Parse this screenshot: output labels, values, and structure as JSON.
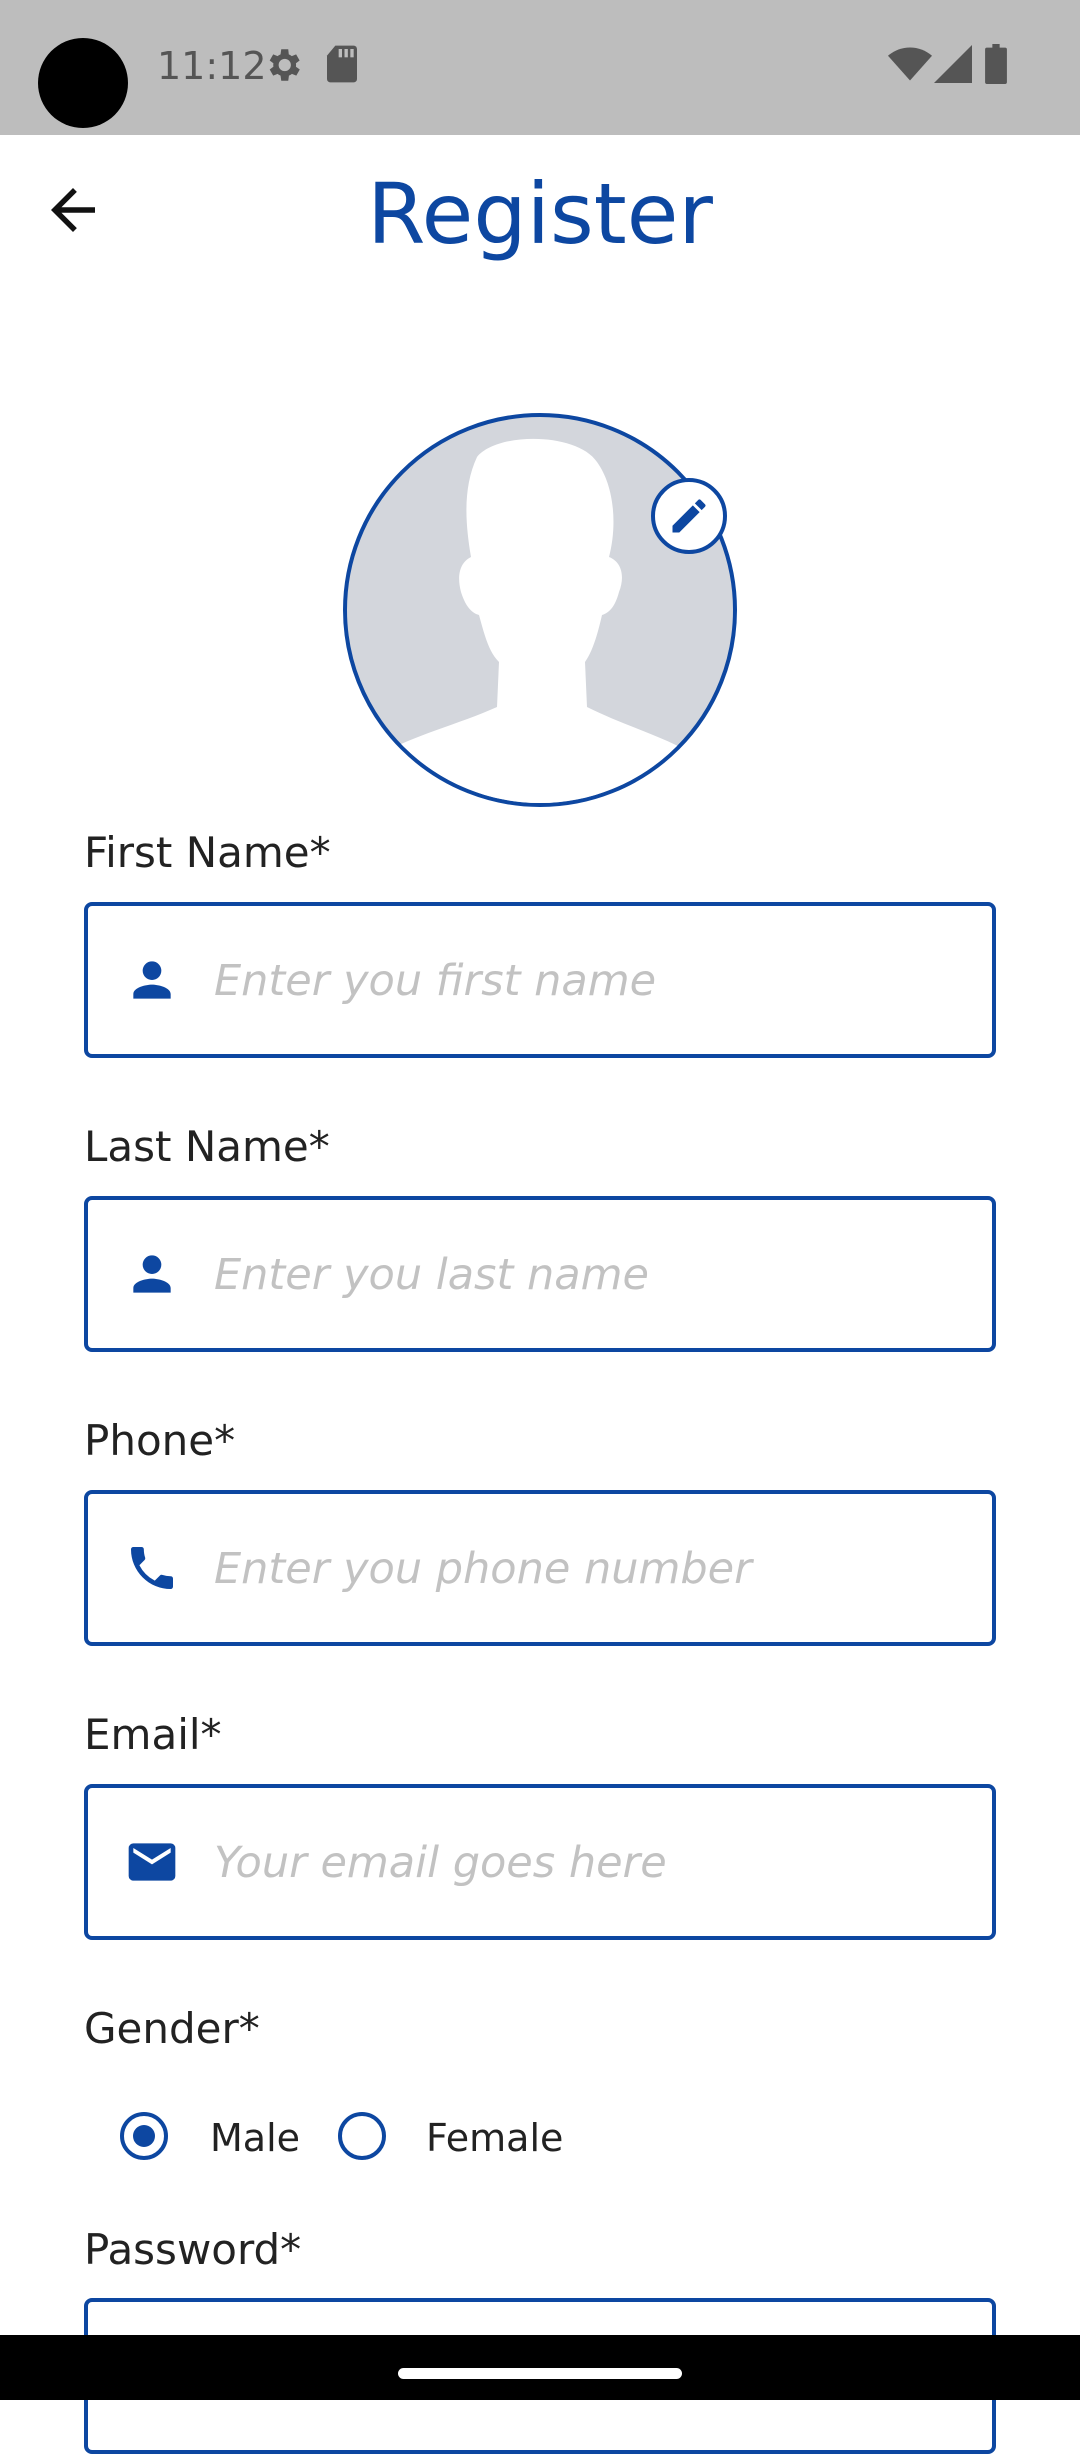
{
  "status_bar": {
    "time": "11:12",
    "icons": [
      "settings-gear-icon",
      "sd-card-icon",
      "wifi-icon",
      "signal-icon",
      "battery-icon"
    ]
  },
  "app_bar": {
    "back_icon": "arrow-back-icon",
    "title": "Register"
  },
  "profile": {
    "avatar_icon": "person-silhouette-icon",
    "edit_icon": "pencil-edit-icon"
  },
  "form": {
    "first_name": {
      "label": "First Name*",
      "placeholder": "Enter you first name",
      "icon": "person-icon"
    },
    "last_name": {
      "label": "Last Name*",
      "placeholder": "Enter you last name",
      "icon": "person-icon"
    },
    "phone": {
      "label": "Phone*",
      "placeholder": "Enter you phone number",
      "icon": "phone-icon"
    },
    "email": {
      "label": "Email*",
      "placeholder": "Your email goes here",
      "icon": "mail-icon"
    },
    "gender": {
      "label": "Gender*",
      "options": [
        {
          "label": "Male",
          "selected": true
        },
        {
          "label": "Female",
          "selected": false
        }
      ]
    },
    "password": {
      "label": "Password*"
    }
  },
  "colors": {
    "primary": "#0d47a1",
    "status_bar": "#bdbdbd",
    "placeholder": "#c2c2c2",
    "avatar_bg": "#d3d6dc"
  }
}
